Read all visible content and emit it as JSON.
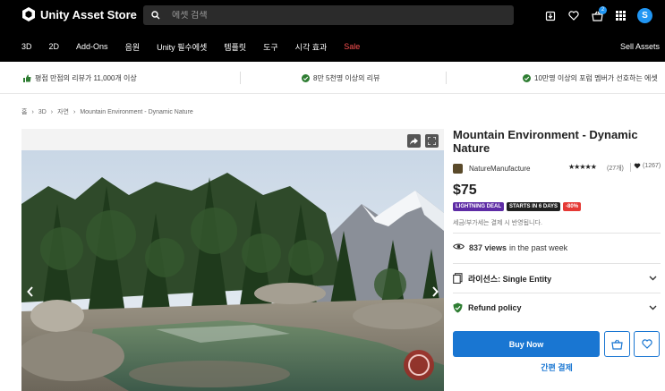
{
  "header": {
    "logo_text": "Unity Asset Store",
    "search_placeholder": "에셋 검색",
    "cart_count": "2",
    "avatar_initial": "S"
  },
  "nav": {
    "items": [
      "3D",
      "2D",
      "Add-Ons",
      "음원",
      "Unity 필수에셋",
      "템플릿",
      "도구",
      "시각 효과",
      "Sale"
    ],
    "sell_label": "Sell Assets"
  },
  "strip": {
    "item1": "평점 만점의 리뷰가 11,000개 이상",
    "item2": "8만 5천명 이상의 리뷰",
    "item3": "10만명 이상의 포럼 멤버가 선호하는 에셋"
  },
  "breadcrumb": [
    "홈",
    "3D",
    "자연",
    "Mountain Environment - Dynamic Nature"
  ],
  "product": {
    "title": "Mountain Environment - Dynamic Nature",
    "publisher": "NatureManufacture",
    "stars": "★★★★★",
    "rating_count": "(27개)",
    "favorites": "(1267)",
    "price": "$75",
    "badge_deal": "LIGHTNING DEAL",
    "badge_days": "STARTS IN 6 DAYS",
    "badge_off": "-80%",
    "tax_note": "세금/부가세는 결제 시 반영됩니다.",
    "views_count": "837 views",
    "views_suffix": "in the past week",
    "license_label": "라이선스: Single Entity",
    "refund_label": "Refund policy",
    "buy_label": "Buy Now",
    "quick_pay_label": "간편 결제"
  },
  "colors": {
    "accent": "#1976d2",
    "sale": "#ff5252",
    "deal_purple": "#5e2ca5",
    "discount_red": "#e53935",
    "check_green": "#2e7d32"
  }
}
